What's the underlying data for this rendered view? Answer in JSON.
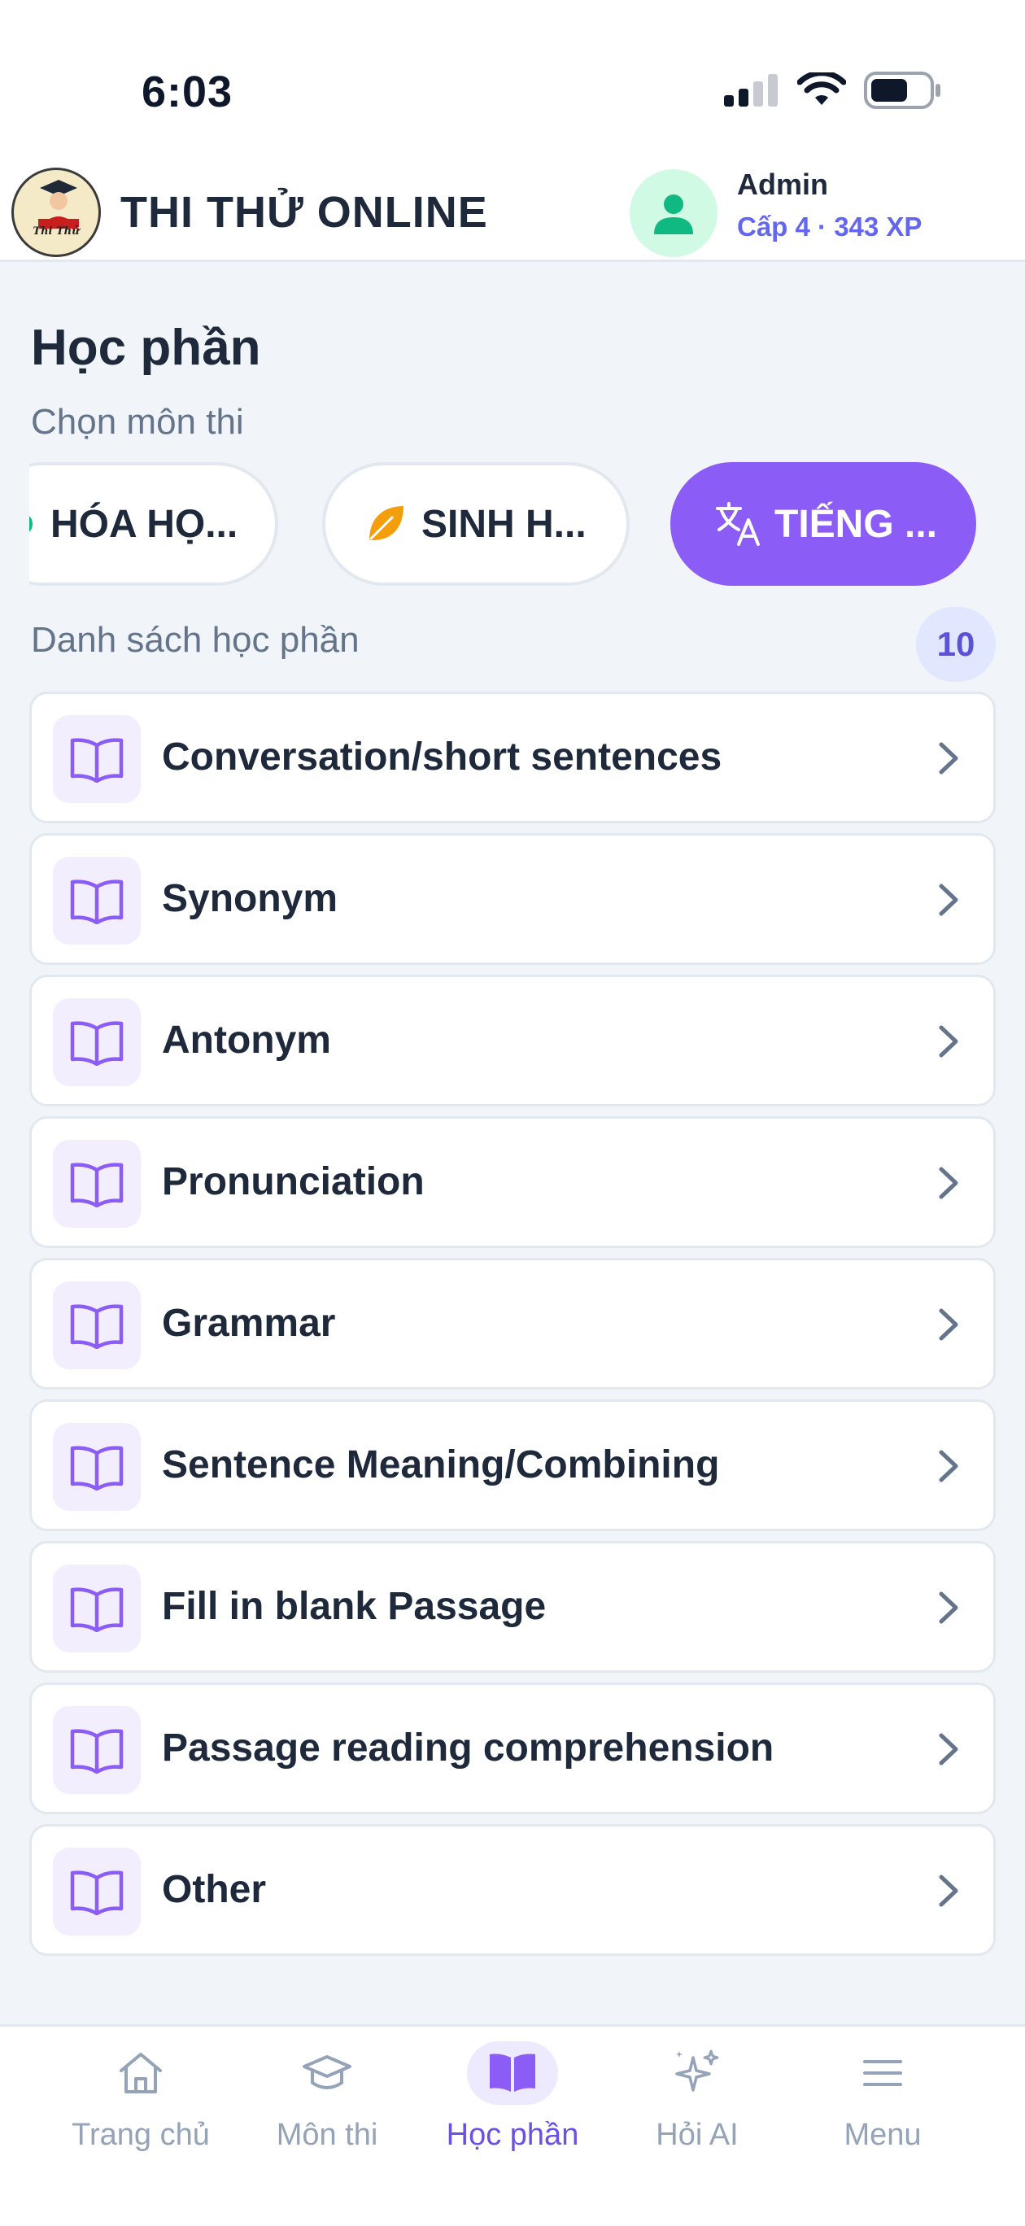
{
  "status_bar": {
    "time": "6:03",
    "icons": [
      "signal-icon",
      "wifi-icon",
      "battery-icon"
    ]
  },
  "header": {
    "logo_text": "Thi Thử",
    "app_title": "THI THỬ ONLINE",
    "user": {
      "name": "Admin",
      "level": "Cấp 4 · 343 XP",
      "avatar_icon": "user-icon"
    }
  },
  "page": {
    "title": "Học phần",
    "subject_label": "Chọn môn thi",
    "subjects": [
      {
        "label": "HÓA HỌ...",
        "icon": "flask-icon",
        "active": false
      },
      {
        "label": "SINH H...",
        "icon": "leaf-icon",
        "active": false
      },
      {
        "label": "TIẾNG ...",
        "icon": "translate-icon",
        "active": true
      }
    ],
    "list_label": "Danh sách học phần",
    "count": "10",
    "modules": [
      {
        "label": "Conversation/short sentences"
      },
      {
        "label": "Synonym"
      },
      {
        "label": "Antonym"
      },
      {
        "label": "Pronunciation"
      },
      {
        "label": "Grammar"
      },
      {
        "label": "Sentence Meaning/Combining"
      },
      {
        "label": "Fill in blank Passage"
      },
      {
        "label": "Passage reading comprehension"
      },
      {
        "label": "Other"
      }
    ]
  },
  "bottom_nav": [
    {
      "label": "Trang chủ",
      "icon": "home-icon",
      "active": false
    },
    {
      "label": "Môn thi",
      "icon": "graduation-cap-icon",
      "active": false
    },
    {
      "label": "Học phần",
      "icon": "book-icon",
      "active": true
    },
    {
      "label": "Hỏi AI",
      "icon": "sparkles-icon",
      "active": false
    },
    {
      "label": "Menu",
      "icon": "menu-icon",
      "active": false
    }
  ],
  "colors": {
    "accent": "#8b5cf6",
    "accent_text": "#6d4fe3",
    "level_text": "#6366f1",
    "avatar_bg": "#d1fae5",
    "avatar_fg": "#10b981",
    "leaf": "#f59e0b",
    "background": "#f1f5f9"
  }
}
